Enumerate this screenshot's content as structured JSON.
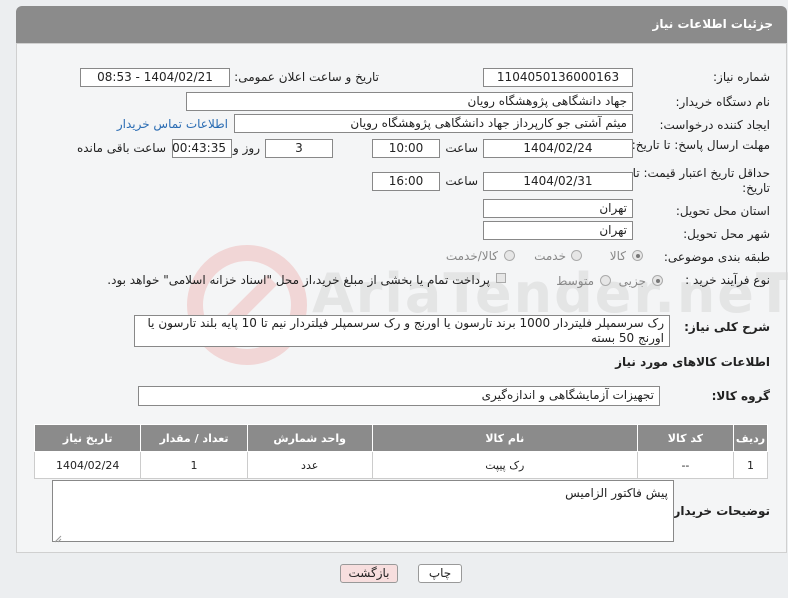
{
  "header": {
    "title": "جزئیات اطلاعات نیاز"
  },
  "form": {
    "need_number_label": "شماره نیاز:",
    "need_number": "1104050136000163",
    "announce_label": "تاریخ و ساعت اعلان عمومی:",
    "announce_value": "1404/02/21 - 08:53",
    "buyer_org_label": "نام دستگاه خریدار:",
    "buyer_org": "جهاد دانشگاهی پژوهشگاه رویان",
    "creator_label": "ایجاد کننده درخواست:",
    "creator": "میثم  آشتی جو کارپرداز جهاد دانشگاهی پژوهشگاه رویان",
    "buyer_contact_link": "اطلاعات تماس خریدار",
    "deadline_label": "مهلت ارسال پاسخ: تا تاریخ:",
    "deadline_date": "1404/02/24",
    "time_label": "ساعت",
    "deadline_time": "10:00",
    "days_value": "3",
    "days_label": "روز و",
    "remaining_time": "00:43:35",
    "remaining_label": "ساعت باقی مانده",
    "price_validity_label": "حداقل تاریخ اعتبار قیمت: تا تاریخ:",
    "price_date": "1404/02/31",
    "price_time": "16:00",
    "province_label": "استان محل تحویل:",
    "province": "تهران",
    "city_label": "شهر محل تحویل:",
    "city": "تهران",
    "category_label": "طبقه بندی موضوعی:",
    "category_options": [
      "کالا",
      "خدمت",
      "کالا/خدمت"
    ],
    "process_label": "نوع فرآیند خرید :",
    "process_options": [
      "جزیی",
      "متوسط"
    ],
    "treasury_text": "پرداخت تمام یا بخشی از مبلغ خرید،از محل \"اسناد خزانه اسلامی\" خواهد بود."
  },
  "description": {
    "label": "شرح کلی نیاز:",
    "text": "رک سرسمپلر فلیتردار 1000 برند تارسون یا اورنج و رک سرسمپلر فیلتردار نیم تا 10 پایه بلند تارسون یا اورنج 50 بسته"
  },
  "goods": {
    "section_title": "اطلاعات کالاهای مورد نیاز",
    "group_label": "گروه کالا:",
    "group_value": "تجهیزات آزمایشگاهی و اندازه‌گیری",
    "columns": [
      "ردیف",
      "کد کالا",
      "نام کالا",
      "واحد شمارش",
      "تعداد / مقدار",
      "تاریخ نیاز"
    ],
    "rows": [
      [
        "1",
        "--",
        "رک پیپت",
        "عدد",
        "1",
        "1404/02/24"
      ]
    ]
  },
  "buyer_notes": {
    "label": "توضیحات خریدار:",
    "text": "پیش فاکتور الزامیس"
  },
  "buttons": {
    "print": "چاپ",
    "back": "بازگشت"
  },
  "watermark": {
    "text": "AriaTender.neT"
  },
  "colors": {
    "header_bg": "#8b8b8b",
    "link": "#2a6cb3",
    "back_btn_bg": "#f7dede"
  }
}
